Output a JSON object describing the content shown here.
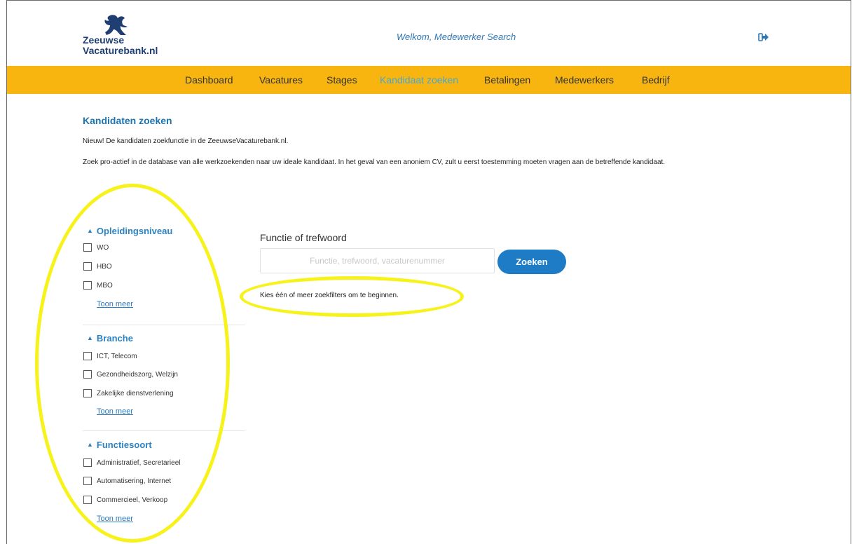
{
  "header": {
    "logo_line1": "Zeeuwse",
    "logo_line2": "Vacaturebank.nl",
    "welcome": "Welkom, Medewerker Search",
    "logout_icon": "logout-icon"
  },
  "nav": {
    "items": [
      {
        "label": "Dashboard"
      },
      {
        "label": "Vacatures"
      },
      {
        "label": "Stages"
      },
      {
        "label": "Kandidaat zoeken"
      },
      {
        "label": "Betalingen"
      },
      {
        "label": "Medewerkers"
      },
      {
        "label": "Bedrijf"
      }
    ],
    "active": "Kandidaat zoeken",
    "bar_color": "#f8b50f"
  },
  "page": {
    "title": "Kandidaten zoeken",
    "intro1": "Nieuw! De kandidaten zoekfunctie in de ZeeuwseVacaturebank.nl.",
    "intro2": "Zoek pro-actief in de database van alle werkzoekenden naar uw ideale kandidaat. In het geval van een anoniem CV, zult u eerst toestemming moeten vragen aan de betreffende kandidaat."
  },
  "filters": [
    {
      "title": "Opleidingsniveau",
      "options": [
        "WO",
        "HBO",
        "MBO"
      ],
      "more": "Toon meer"
    },
    {
      "title": "Branche",
      "options": [
        "ICT, Telecom",
        "Gezondheidszorg, Welzijn",
        "Zakelijke dienstverlening"
      ],
      "more": "Toon meer"
    },
    {
      "title": "Functiesoort",
      "options": [
        "Administratief, Secretarieel",
        "Automatisering, Internet",
        "Commercieel, Verkoop"
      ],
      "more": "Toon meer"
    }
  ],
  "search": {
    "label": "Functie of trefwoord",
    "placeholder": "Functie, trefwoord, vacaturenummer",
    "value": "",
    "button": "Zoeken",
    "hint": "Kies één of meer zoekfilters om te beginnen."
  },
  "colors": {
    "accent": "#1e7bc5",
    "title": "#1d74ad",
    "annotation": "#f7f21a"
  }
}
